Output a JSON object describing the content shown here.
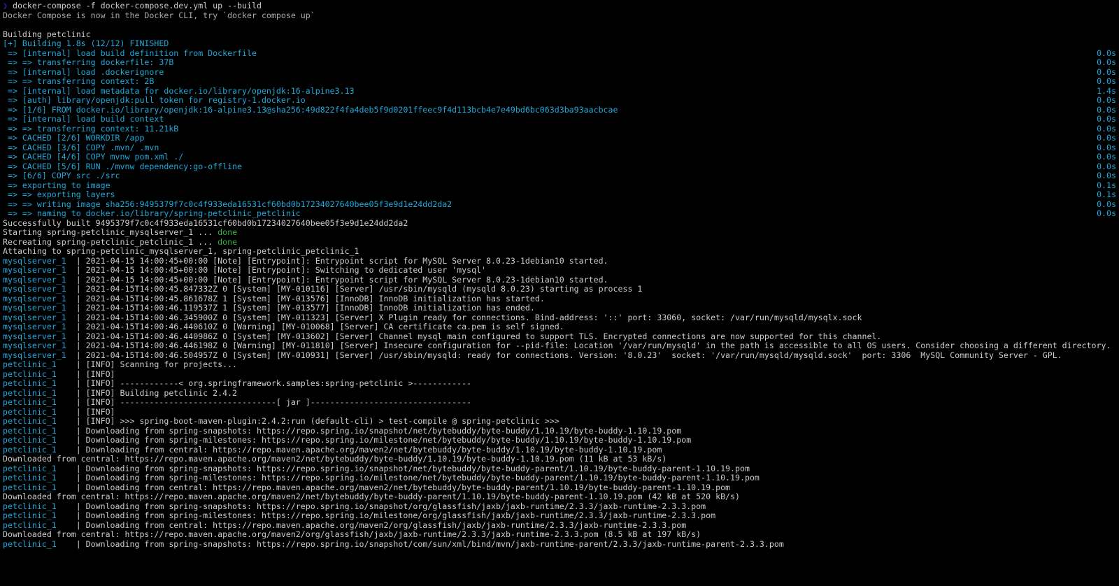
{
  "prompt_glyph": "❯",
  "command": "docker-compose -f docker-compose.dev.yml up --build",
  "preamble": "Docker Compose is now in the Docker CLI, try `docker compose up`",
  "blank_after_preamble": "",
  "build_header": "Building petclinic",
  "progress_header": "[+] Building 1.8s (12/12) FINISHED",
  "steps": [
    {
      "l": " => [internal] load build definition from Dockerfile",
      "r": "0.0s"
    },
    {
      "l": " => => transferring dockerfile: 37B",
      "r": "0.0s"
    },
    {
      "l": " => [internal] load .dockerignore",
      "r": "0.0s"
    },
    {
      "l": " => => transferring context: 2B",
      "r": "0.0s"
    },
    {
      "l": " => [internal] load metadata for docker.io/library/openjdk:16-alpine3.13",
      "r": "1.4s"
    },
    {
      "l": " => [auth] library/openjdk:pull token for registry-1.docker.io",
      "r": "0.0s"
    },
    {
      "l": " => [1/6] FROM docker.io/library/openjdk:16-alpine3.13@sha256:49d822f4fa4deb5f9d0201ffeec9f4d113bcb4e7e49bd6bc063d3ba93aacbcae",
      "r": "0.0s"
    },
    {
      "l": " => [internal] load build context",
      "r": "0.0s"
    },
    {
      "l": " => => transferring context: 11.21kB",
      "r": "0.0s"
    },
    {
      "l": " => CACHED [2/6] WORKDIR /app",
      "r": "0.0s"
    },
    {
      "l": " => CACHED [3/6] COPY .mvn/ .mvn",
      "r": "0.0s"
    },
    {
      "l": " => CACHED [4/6] COPY mvnw pom.xml ./",
      "r": "0.0s"
    },
    {
      "l": " => CACHED [5/6] RUN ./mvnw dependency:go-offline",
      "r": "0.0s"
    },
    {
      "l": " => [6/6] COPY src ./src",
      "r": "0.0s"
    },
    {
      "l": " => exporting to image",
      "r": "0.1s"
    },
    {
      "l": " => => exporting layers",
      "r": "0.1s"
    },
    {
      "l": " => => writing image sha256:9495379f7c0c4f933eda16531cf60bd0b17234027640bee05f3e9d1e24dd2da2",
      "r": "0.0s"
    },
    {
      "l": " => => naming to docker.io/library/spring-petclinic_petclinic",
      "r": "0.0s"
    }
  ],
  "post_build": [
    "Successfully built 9495379f7c0c4f933eda16531cf60bd0b17234027640bee05f3e9d1e24dd2da2"
  ],
  "starting_prefix": "Starting spring-petclinic_mysqlserver_1 ... ",
  "recreating_prefix": "Recreating spring-petclinic_petclinic_1 ... ",
  "done_word": "done",
  "attach_line": "Attaching to spring-petclinic_mysqlserver_1, spring-petclinic_petclinic_1",
  "log_lines": [
    {
      "svc": "mysqlserver_1",
      "txt": "| 2021-04-15 14:00:45+00:00 [Note] [Entrypoint]: Entrypoint script for MySQL Server 8.0.23-1debian10 started."
    },
    {
      "svc": "mysqlserver_1",
      "txt": "| 2021-04-15 14:00:45+00:00 [Note] [Entrypoint]: Switching to dedicated user 'mysql'"
    },
    {
      "svc": "mysqlserver_1",
      "txt": "| 2021-04-15 14:00:45+00:00 [Note] [Entrypoint]: Entrypoint script for MySQL Server 8.0.23-1debian10 started."
    },
    {
      "svc": "mysqlserver_1",
      "txt": "| 2021-04-15T14:00:45.847332Z 0 [System] [MY-010116] [Server] /usr/sbin/mysqld (mysqld 8.0.23) starting as process 1"
    },
    {
      "svc": "mysqlserver_1",
      "txt": "| 2021-04-15T14:00:45.861678Z 1 [System] [MY-013576] [InnoDB] InnoDB initialization has started."
    },
    {
      "svc": "mysqlserver_1",
      "txt": "| 2021-04-15T14:00:46.119537Z 1 [System] [MY-013577] [InnoDB] InnoDB initialization has ended."
    },
    {
      "svc": "mysqlserver_1",
      "txt": "| 2021-04-15T14:00:46.345900Z 0 [System] [MY-011323] [Server] X Plugin ready for connections. Bind-address: '::' port: 33060, socket: /var/run/mysqld/mysqlx.sock"
    },
    {
      "svc": "mysqlserver_1",
      "txt": "| 2021-04-15T14:00:46.440610Z 0 [Warning] [MY-010068] [Server] CA certificate ca.pem is self signed."
    },
    {
      "svc": "mysqlserver_1",
      "txt": "| 2021-04-15T14:00:46.440986Z 0 [System] [MY-013602] [Server] Channel mysql_main configured to support TLS. Encrypted connections are now supported for this channel."
    },
    {
      "svc": "mysqlserver_1",
      "txt": "| 2021-04-15T14:00:46.446198Z 0 [Warning] [MY-011810] [Server] Insecure configuration for --pid-file: Location '/var/run/mysqld' in the path is accessible to all OS users. Consider choosing a different directory."
    },
    {
      "svc": "mysqlserver_1",
      "txt": "| 2021-04-15T14:00:46.504957Z 0 [System] [MY-010931] [Server] /usr/sbin/mysqld: ready for connections. Version: '8.0.23'  socket: '/var/run/mysqld/mysqld.sock'  port: 3306  MySQL Community Server - GPL."
    },
    {
      "svc": "petclinic_1",
      "txt": "  | [INFO] Scanning for projects..."
    },
    {
      "svc": "petclinic_1",
      "txt": "  | [INFO]"
    },
    {
      "svc": "petclinic_1",
      "txt": "  | [INFO] ------------< org.springframework.samples:spring-petclinic >------------"
    },
    {
      "svc": "petclinic_1",
      "txt": "  | [INFO] Building petclinic 2.4.2"
    },
    {
      "svc": "petclinic_1",
      "txt": "  | [INFO] --------------------------------[ jar ]---------------------------------"
    },
    {
      "svc": "petclinic_1",
      "txt": "  | [INFO]"
    },
    {
      "svc": "petclinic_1",
      "txt": "  | [INFO] >>> spring-boot-maven-plugin:2.4.2:run (default-cli) > test-compile @ spring-petclinic >>>"
    },
    {
      "svc": "petclinic_1",
      "txt": "  | Downloading from spring-snapshots: https://repo.spring.io/snapshot/net/bytebuddy/byte-buddy/1.10.19/byte-buddy-1.10.19.pom"
    },
    {
      "svc": "petclinic_1",
      "txt": "  | Downloading from spring-milestones: https://repo.spring.io/milestone/net/bytebuddy/byte-buddy/1.10.19/byte-buddy-1.10.19.pom"
    },
    {
      "svc": "petclinic_1",
      "txt": "  | Downloading from central: https://repo.maven.apache.org/maven2/net/bytebuddy/byte-buddy/1.10.19/byte-buddy-1.10.19.pom"
    },
    {
      "svc": "",
      "txt": "Downloaded from central: https://repo.maven.apache.org/maven2/net/bytebuddy/byte-buddy/1.10.19/byte-buddy-1.10.19.pom (11 kB at 53 kB/s)"
    },
    {
      "svc": "petclinic_1",
      "txt": "  | Downloading from spring-snapshots: https://repo.spring.io/snapshot/net/bytebuddy/byte-buddy-parent/1.10.19/byte-buddy-parent-1.10.19.pom"
    },
    {
      "svc": "petclinic_1",
      "txt": "  | Downloading from spring-milestones: https://repo.spring.io/milestone/net/bytebuddy/byte-buddy-parent/1.10.19/byte-buddy-parent-1.10.19.pom"
    },
    {
      "svc": "petclinic_1",
      "txt": "  | Downloading from central: https://repo.maven.apache.org/maven2/net/bytebuddy/byte-buddy-parent/1.10.19/byte-buddy-parent-1.10.19.pom"
    },
    {
      "svc": "",
      "txt": "Downloaded from central: https://repo.maven.apache.org/maven2/net/bytebuddy/byte-buddy-parent/1.10.19/byte-buddy-parent-1.10.19.pom (42 kB at 520 kB/s)"
    },
    {
      "svc": "petclinic_1",
      "txt": "  | Downloading from spring-snapshots: https://repo.spring.io/snapshot/org/glassfish/jaxb/jaxb-runtime/2.3.3/jaxb-runtime-2.3.3.pom"
    },
    {
      "svc": "petclinic_1",
      "txt": "  | Downloading from spring-milestones: https://repo.spring.io/milestone/org/glassfish/jaxb/jaxb-runtime/2.3.3/jaxb-runtime-2.3.3.pom"
    },
    {
      "svc": "petclinic_1",
      "txt": "  | Downloading from central: https://repo.maven.apache.org/maven2/org/glassfish/jaxb/jaxb-runtime/2.3.3/jaxb-runtime-2.3.3.pom"
    },
    {
      "svc": "",
      "txt": "Downloaded from central: https://repo.maven.apache.org/maven2/org/glassfish/jaxb/jaxb-runtime/2.3.3/jaxb-runtime-2.3.3.pom (8.5 kB at 197 kB/s)"
    },
    {
      "svc": "petclinic_1",
      "txt": "  | Downloading from spring-snapshots: https://repo.spring.io/snapshot/com/sun/xml/bind/mvn/jaxb-runtime-parent/2.3.3/jaxb-runtime-parent-2.3.3.pom"
    }
  ]
}
